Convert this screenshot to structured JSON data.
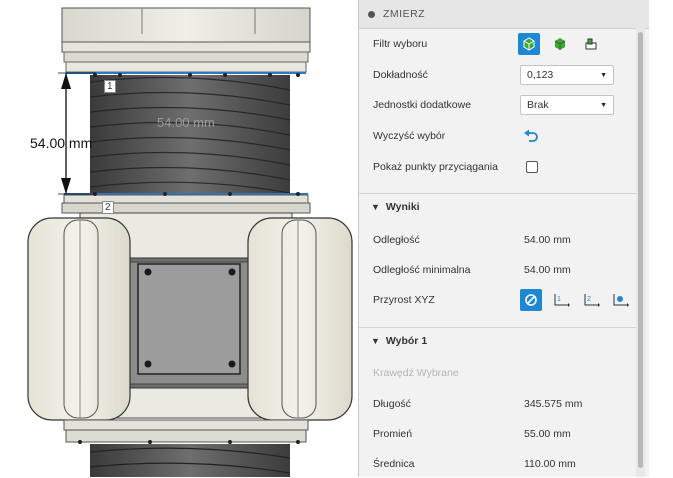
{
  "viewport": {
    "dimension_label": "54.00 mm",
    "ghost_label": "54.00 mm",
    "point_labels": [
      "1",
      "2"
    ]
  },
  "panel": {
    "title": "ZMIERZ",
    "filter": {
      "label": "Filtr wyboru"
    },
    "precision": {
      "label": "Dokładność",
      "value": "0,123"
    },
    "units": {
      "label": "Jednostki dodatkowe",
      "value": "Brak"
    },
    "clear": {
      "label": "Wyczyść wybór"
    },
    "snap": {
      "label": "Pokaż punkty przyciągania"
    },
    "results": {
      "heading": "Wyniki",
      "distance": {
        "label": "Odległość",
        "value": "54.00 mm"
      },
      "min_distance": {
        "label": "Odległość minimalna",
        "value": "54.00 mm"
      },
      "xyz": {
        "label": "Przyrost XYZ"
      }
    },
    "selection1": {
      "heading": "Wybór 1",
      "status": "Krawędź Wybrane",
      "length": {
        "label": "Długość",
        "value": "345.575 mm"
      },
      "radius": {
        "label": "Promień",
        "value": "55.00 mm"
      },
      "diameter": {
        "label": "Średnica",
        "value": "110.00 mm"
      }
    }
  },
  "colors": {
    "accent": "#1e88d4",
    "green": "#3aaa35"
  }
}
